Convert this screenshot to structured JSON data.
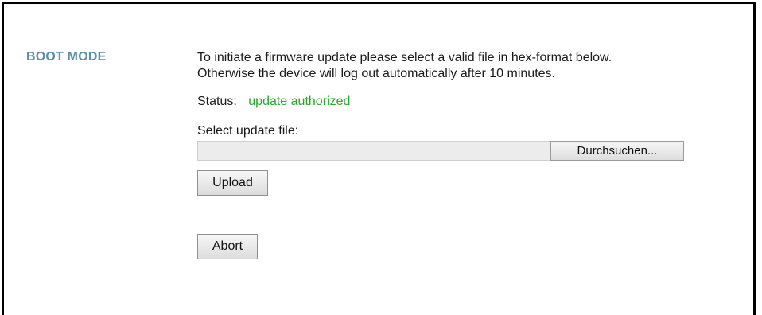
{
  "section": {
    "title": "BOOT MODE"
  },
  "intro": {
    "line1": "To initiate a firmware update please select a valid file in hex-format below.",
    "line2": "Otherwise the device will log out automatically after 10 minutes."
  },
  "status": {
    "label": "Status:",
    "value": "update authorized",
    "value_color": "#2aa72a"
  },
  "file": {
    "label": "Select update file:",
    "path_value": "",
    "browse_label": "Durchsuchen..."
  },
  "actions": {
    "upload_label": "Upload",
    "abort_label": "Abort"
  },
  "colors": {
    "section_title": "#5b8fa8"
  }
}
